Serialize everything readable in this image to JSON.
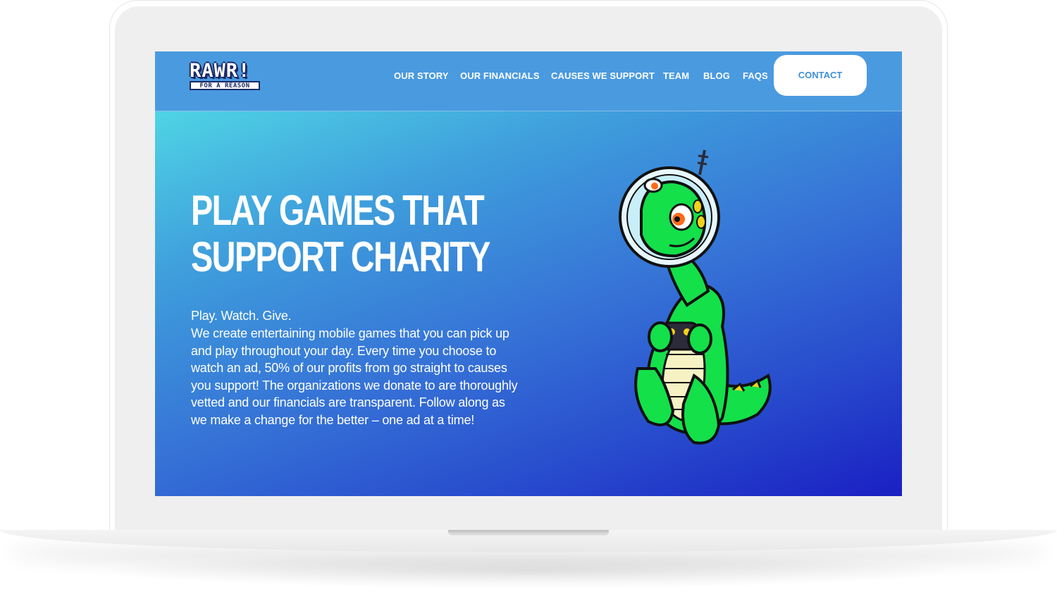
{
  "brand": {
    "logo_top": "RAWR!",
    "logo_bottom": "FOR A REASON"
  },
  "nav": {
    "items": [
      {
        "label": "OUR STORY"
      },
      {
        "label": "OUR FINANCIALS"
      },
      {
        "label": "CAUSES WE SUPPORT"
      },
      {
        "label": "TEAM"
      },
      {
        "label": "BLOG"
      },
      {
        "label": "FAQS"
      }
    ],
    "contact_label": "CONTACT"
  },
  "hero": {
    "title_line1": "PLAY GAMES THAT",
    "title_line2": "SUPPORT CHARITY",
    "tagline": "Play. Watch. Give.",
    "body": "We create entertaining mobile games that you can pick up and play throughout your day. Every time you choose to watch an ad, 50% of our profits from go straight to causes you support! The organizations we donate to are thoroughly vetted and our financials are transparent. Follow along as we make a change for the better – one ad at a time!"
  },
  "colors": {
    "nav_bg": "#4a9ae0",
    "gradient_start": "#4fd4e5",
    "gradient_end": "#1a20c2",
    "contact_text": "#3d8fd6",
    "mascot_green": "#14e04a"
  },
  "icons": {
    "mascot": "dinosaur-astronaut-with-gamepad"
  }
}
